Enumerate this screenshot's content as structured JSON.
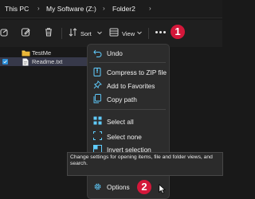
{
  "breadcrumb": [
    "This PC",
    "My Software (Z:)",
    "Folder2"
  ],
  "toolbar": {
    "sort_label": "Sort",
    "view_label": "View",
    "more_label": "..."
  },
  "files": [
    {
      "name": "TestMe",
      "type": "folder",
      "selected": false
    },
    {
      "name": "Readme.txt",
      "type": "file",
      "selected": true
    }
  ],
  "menu": {
    "undo": "Undo",
    "compress": "Compress to ZIP file",
    "favorites": "Add to Favorites",
    "copy_path": "Copy path",
    "select_all": "Select all",
    "select_none": "Select none",
    "invert": "Invert selection",
    "options": "Options"
  },
  "tooltip": "Change settings for opening items, file and folder views, and search.",
  "badges": [
    "1",
    "2"
  ],
  "colors": {
    "accent": "#60cdff",
    "badge": "#d4173a",
    "folder": "#f4c54d"
  }
}
